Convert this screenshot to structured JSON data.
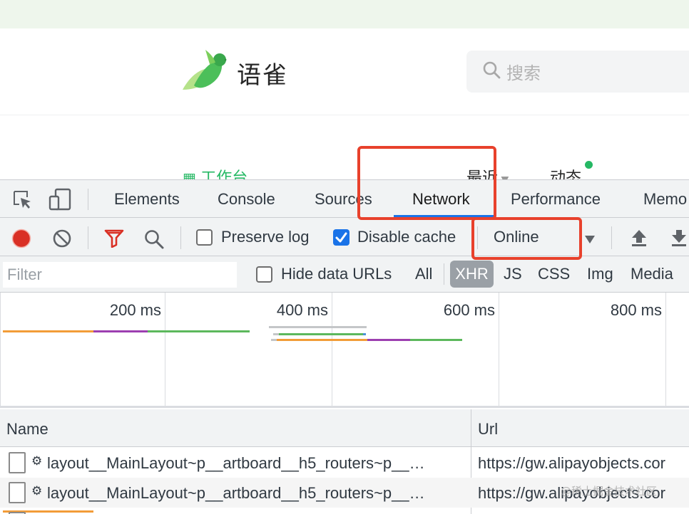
{
  "site": {
    "logo_text": "语雀",
    "search_placeholder": "搜索",
    "nav": {
      "workbench": "工作台",
      "recent": "最近",
      "activity": "动态"
    }
  },
  "devtools": {
    "tabs": [
      "Elements",
      "Console",
      "Sources",
      "Network",
      "Performance",
      "Memo"
    ],
    "active_tab": "Network",
    "toolbar": {
      "preserve_log_label": "Preserve log",
      "preserve_log_checked": false,
      "disable_cache_label": "Disable cache",
      "disable_cache_checked": true,
      "throttle_value": "Online"
    },
    "filter": {
      "placeholder": "Filter",
      "hide_data_urls_label": "Hide data URLs",
      "hide_data_urls_checked": false,
      "types": [
        "All",
        "XHR",
        "JS",
        "CSS",
        "Img",
        "Media"
      ],
      "selected_type": "XHR"
    },
    "timeline": {
      "ticks": [
        "200 ms",
        "400 ms",
        "600 ms",
        "800 ms"
      ]
    },
    "table": {
      "columns": [
        "Name",
        "Url"
      ],
      "rows": [
        {
          "name": "layout__MainLayout~p__artboard__h5_routers~p__…",
          "url": "https://gw.alipayobjects.cor"
        },
        {
          "name": "layout__MainLayout~p__artboard__h5_routers~p__…",
          "url": "https://gw.alipayobjects.cor"
        }
      ]
    }
  },
  "watermark": "@稀土掘金技术社区",
  "colors": {
    "brand_green": "#25b864",
    "devtools_bg": "#f1f3f4",
    "accent_blue": "#1a73e8",
    "record_red": "#d93025",
    "highlight_red": "#e8412c"
  }
}
